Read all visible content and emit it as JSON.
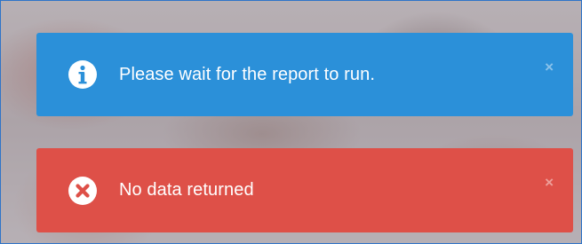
{
  "alerts": [
    {
      "type": "info",
      "icon": "info-circle-icon",
      "message": "Please wait for the report to run.",
      "close_label": "×",
      "color": "#2b90d9"
    },
    {
      "type": "error",
      "icon": "error-circle-icon",
      "message": "No data returned",
      "close_label": "×",
      "color": "#de5048"
    }
  ]
}
